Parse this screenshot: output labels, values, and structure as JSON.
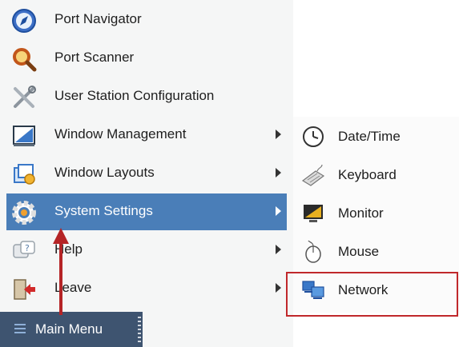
{
  "main_menu": {
    "items": [
      {
        "label": "Port Navigator",
        "icon": "compass-icon",
        "submenu": false
      },
      {
        "label": "Port Scanner",
        "icon": "magnifier-icon",
        "submenu": false
      },
      {
        "label": "User Station Configuration",
        "icon": "tools-icon",
        "submenu": false
      },
      {
        "label": "Window Management",
        "icon": "window-management-icon",
        "submenu": true
      },
      {
        "label": "Window Layouts",
        "icon": "window-layouts-icon",
        "submenu": true
      },
      {
        "label": "System Settings",
        "icon": "gear-icon",
        "submenu": true,
        "active": true
      },
      {
        "label": "Help",
        "icon": "help-icon",
        "submenu": true
      },
      {
        "label": "Leave",
        "icon": "leave-icon",
        "submenu": true
      }
    ]
  },
  "system_settings_submenu": {
    "items": [
      {
        "label": "Date/Time",
        "icon": "clock-icon"
      },
      {
        "label": "Keyboard",
        "icon": "keyboard-icon"
      },
      {
        "label": "Monitor",
        "icon": "monitor-icon"
      },
      {
        "label": "Mouse",
        "icon": "mouse-icon"
      },
      {
        "label": "Network",
        "icon": "network-icon",
        "highlighted": true
      }
    ]
  },
  "taskbar": {
    "main_menu_label": "Main Menu",
    "icon": "hamburger-icon"
  },
  "colors": {
    "active_item_bg": "#4a7eb8",
    "taskbar_bg": "#3e5470",
    "annotation_red": "#c0282b",
    "menu_bg": "#f5f6f6"
  }
}
